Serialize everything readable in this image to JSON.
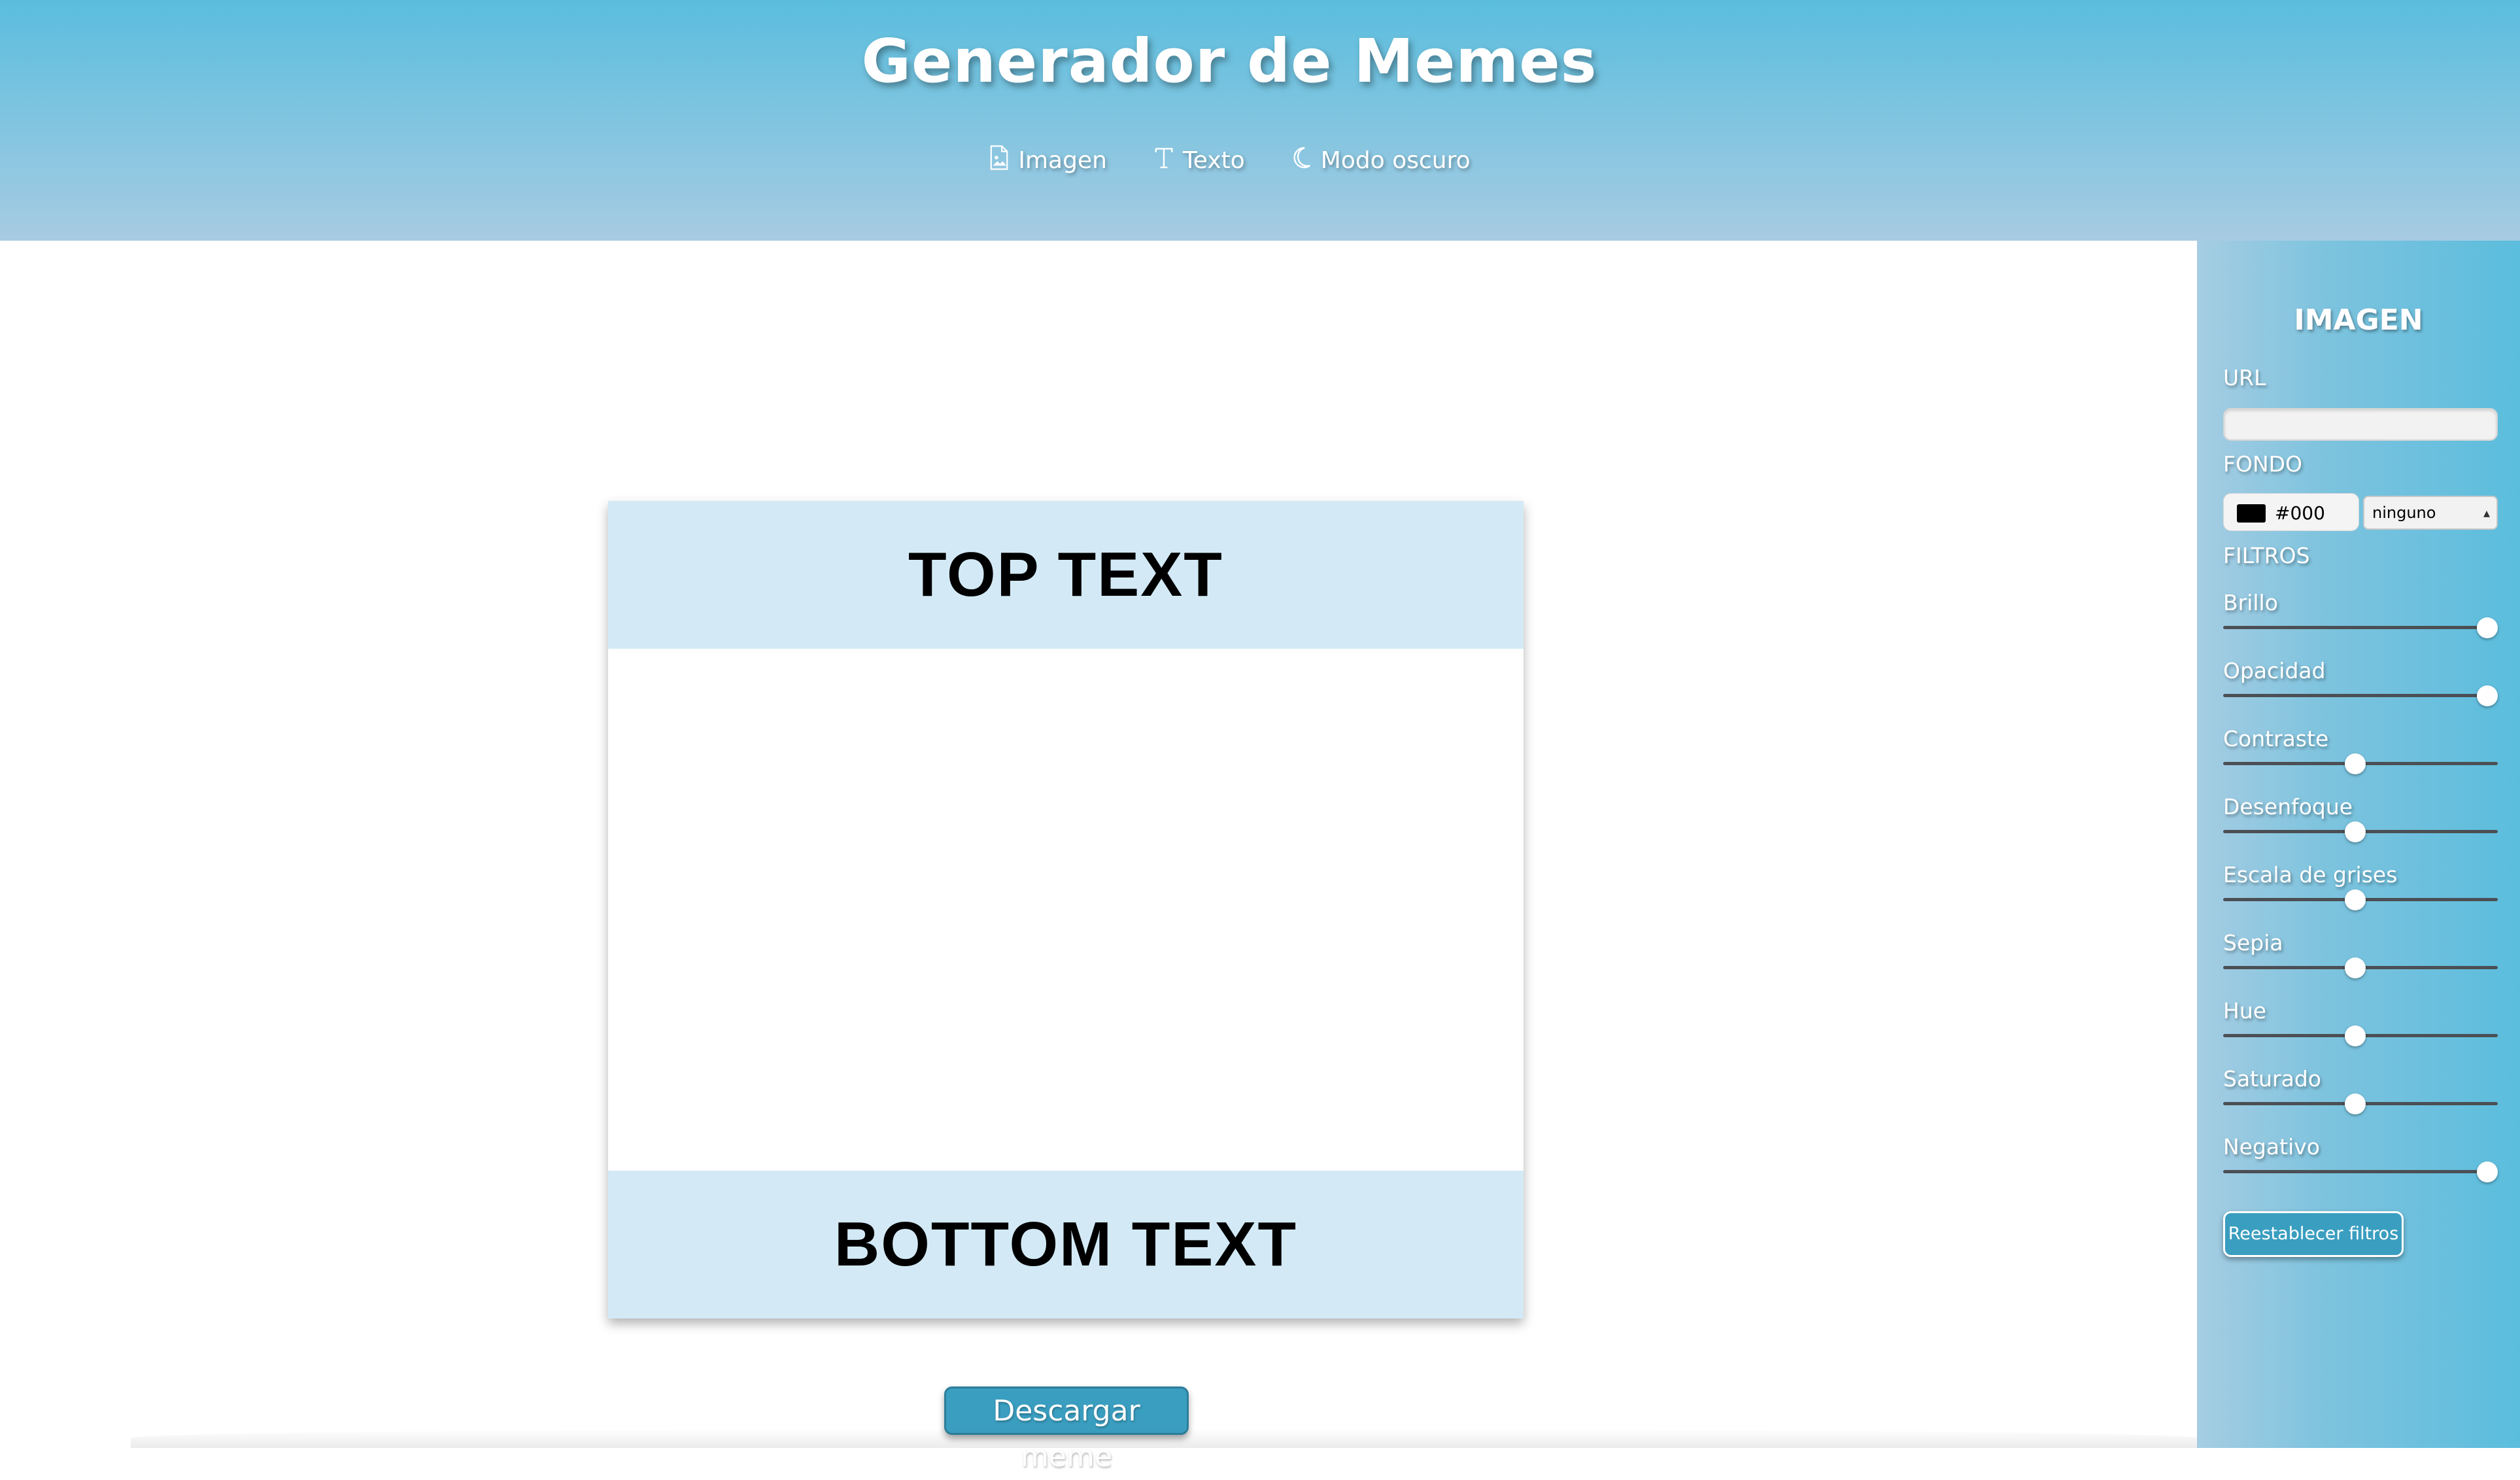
{
  "header": {
    "title": "Generador de Memes",
    "nav": [
      {
        "label": "Imagen",
        "icon": "image-file-icon"
      },
      {
        "label": "Texto",
        "icon": "text-icon"
      },
      {
        "label": "Modo oscuro",
        "icon": "moon-icon"
      }
    ]
  },
  "meme": {
    "top_text": "TOP TEXT",
    "bottom_text": "BOTTOM TEXT",
    "download_label": "Descargar meme"
  },
  "panel": {
    "title": "IMAGEN",
    "url_label": "URL",
    "url_value": "",
    "fondo_label": "FONDO",
    "color_value": "#000",
    "blend_mode": "ninguno",
    "filtros_label": "FILTROS",
    "filters": [
      {
        "label": "Brillo",
        "level": 1.0
      },
      {
        "label": "Opacidad",
        "level": 1.0
      },
      {
        "label": "Contraste",
        "level": 0.5
      },
      {
        "label": "Desenfoque",
        "level": 0.5
      },
      {
        "label": "Escala de grises",
        "level": 0.5
      },
      {
        "label": "Sepia",
        "level": 0.5
      },
      {
        "label": "Hue",
        "level": 0.5
      },
      {
        "label": "Saturado",
        "level": 0.5
      },
      {
        "label": "Negativo",
        "level": 1.0
      }
    ],
    "reset_label": "Reestablecer filtros"
  },
  "colors": {
    "header_top": "#5bbddd",
    "header_bottom": "#a7cbe2",
    "meme_band": "#d3eaf6",
    "button": "#3a9ec0"
  }
}
